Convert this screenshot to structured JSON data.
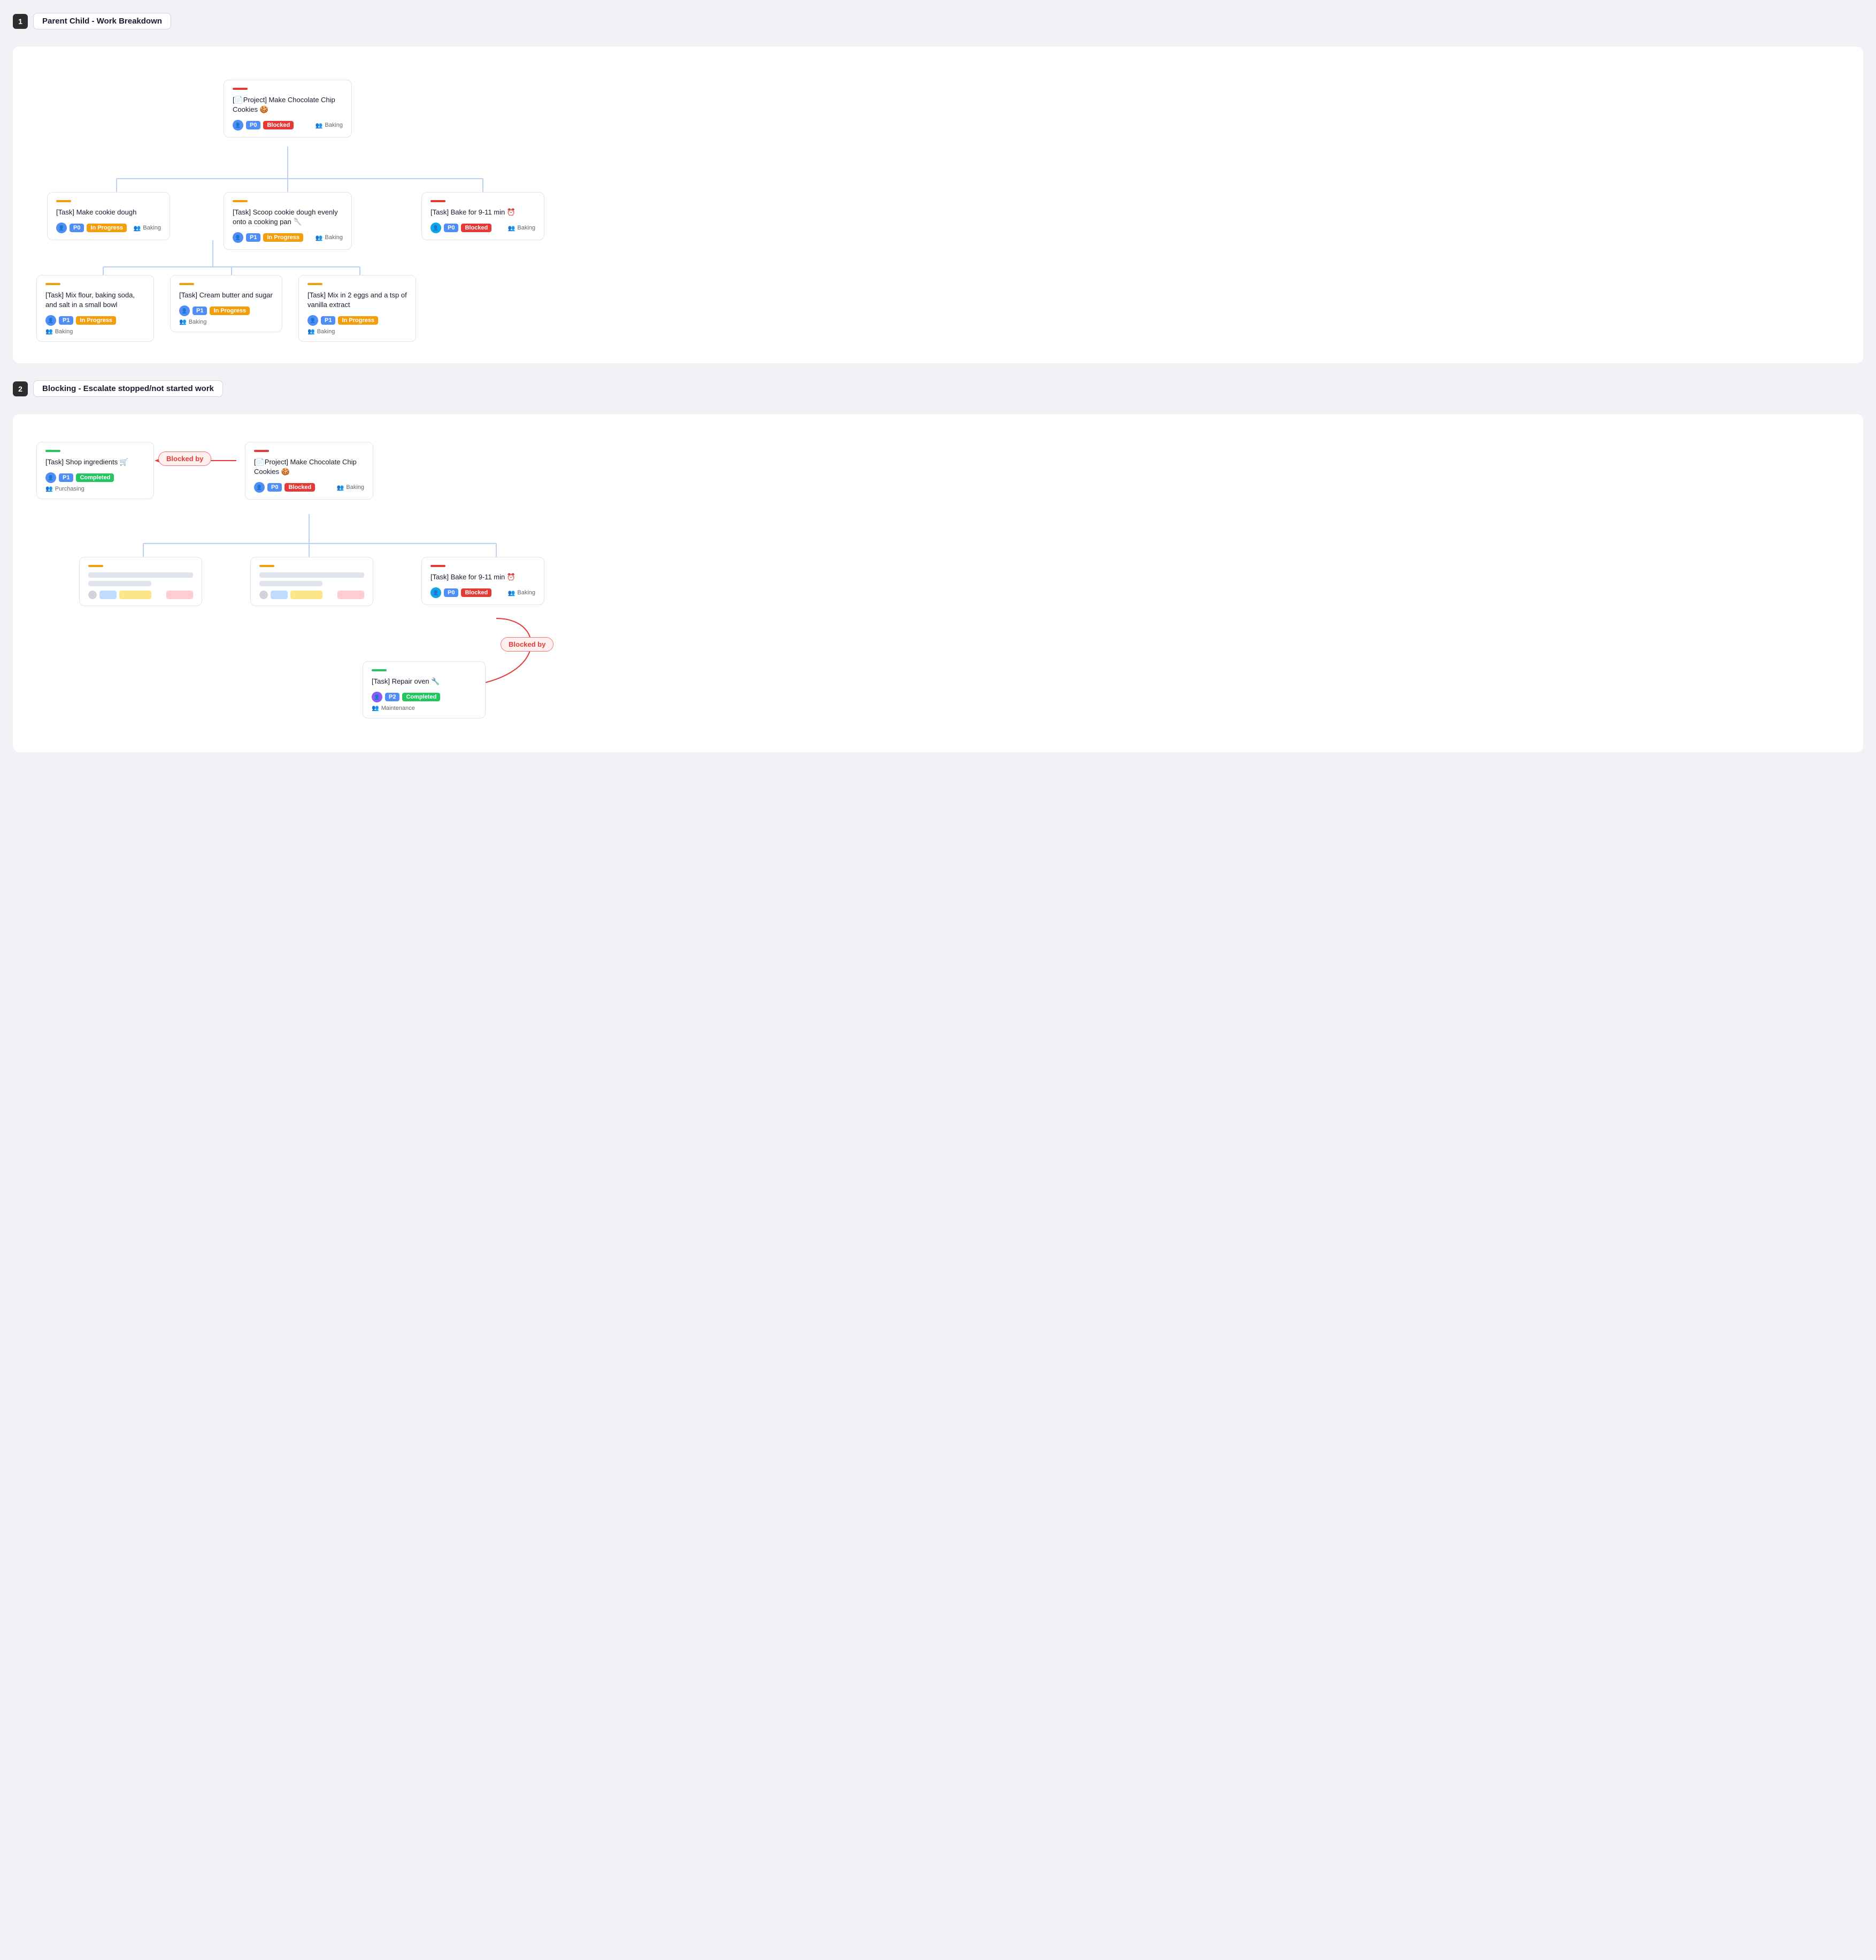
{
  "sections": [
    {
      "number": "1",
      "title": "Parent Child - Work Breakdown",
      "cards": {
        "root": {
          "bar": "bar-red",
          "icon": "📄",
          "title": "[📄Project] Make Chocolate Chip Cookies 🍪",
          "priority": "P0",
          "status": "Blocked",
          "status_class": "badge-blocked",
          "team": "Baking",
          "avatar_color": "avatar-blue"
        },
        "l1_1": {
          "bar": "bar-orange",
          "title": "[Task] Make cookie dough",
          "priority": "P0",
          "status": "In Progress",
          "status_class": "badge-inprogress",
          "team": "Baking",
          "avatar_color": "avatar-blue"
        },
        "l1_2": {
          "bar": "bar-orange",
          "title": "[Task] Scoop cookie dough evenly onto a cooking pan 🥄",
          "priority": "P1",
          "status": "In Progress",
          "status_class": "badge-inprogress",
          "team": "Baking",
          "avatar_color": "avatar-blue"
        },
        "l1_3": {
          "bar": "bar-red",
          "title": "[Task] Bake for 9-11 min ⏰",
          "priority": "P0",
          "status": "Blocked",
          "status_class": "badge-blocked",
          "team": "Baking",
          "avatar_color": "avatar-teal"
        },
        "l2_1": {
          "bar": "bar-orange",
          "title": "[Task] Mix flour, baking soda, and salt in a small bowl",
          "priority": "P1",
          "status": "In Progress",
          "status_class": "badge-inprogress",
          "team": "Baking",
          "avatar_color": "avatar-blue"
        },
        "l2_2": {
          "bar": "bar-orange",
          "title": "[Task] Cream butter and sugar",
          "priority": "P1",
          "status": "In Progress",
          "status_class": "badge-inprogress",
          "team": "Baking",
          "avatar_color": "avatar-blue"
        },
        "l2_3": {
          "bar": "bar-orange",
          "title": "[Task] Mix in 2 eggs and a tsp of vanilla extract",
          "priority": "P1",
          "status": "In Progress",
          "status_class": "badge-inprogress",
          "team": "Baking",
          "avatar_color": "avatar-blue"
        }
      }
    },
    {
      "number": "2",
      "title": "Blocking - Escalate stopped/not started work",
      "cards": {
        "shop": {
          "bar": "bar-green",
          "title": "[Task] Shop ingredients 🛒",
          "priority": "P1",
          "status": "Completed",
          "status_class": "badge-completed",
          "team": "Purchasing",
          "avatar_color": "avatar-blue"
        },
        "root": {
          "bar": "bar-red",
          "title": "[📄Project] Make Chocolate Chip Cookies 🍪",
          "priority": "P0",
          "status": "Blocked",
          "status_class": "badge-blocked",
          "team": "Baking",
          "avatar_color": "avatar-blue"
        },
        "bake": {
          "bar": "bar-red",
          "title": "[Task] Bake for 9-11 min ⏰",
          "priority": "P0",
          "status": "Blocked",
          "status_class": "badge-blocked",
          "team": "Baking",
          "avatar_color": "avatar-teal"
        },
        "repair": {
          "bar": "bar-green",
          "title": "[Task] Repair oven 🔧",
          "priority": "P2",
          "status": "Completed",
          "status_class": "badge-completed",
          "team": "Maintenance",
          "avatar_color": "avatar-purple"
        }
      },
      "blocked_by": "Blocked by"
    }
  ]
}
